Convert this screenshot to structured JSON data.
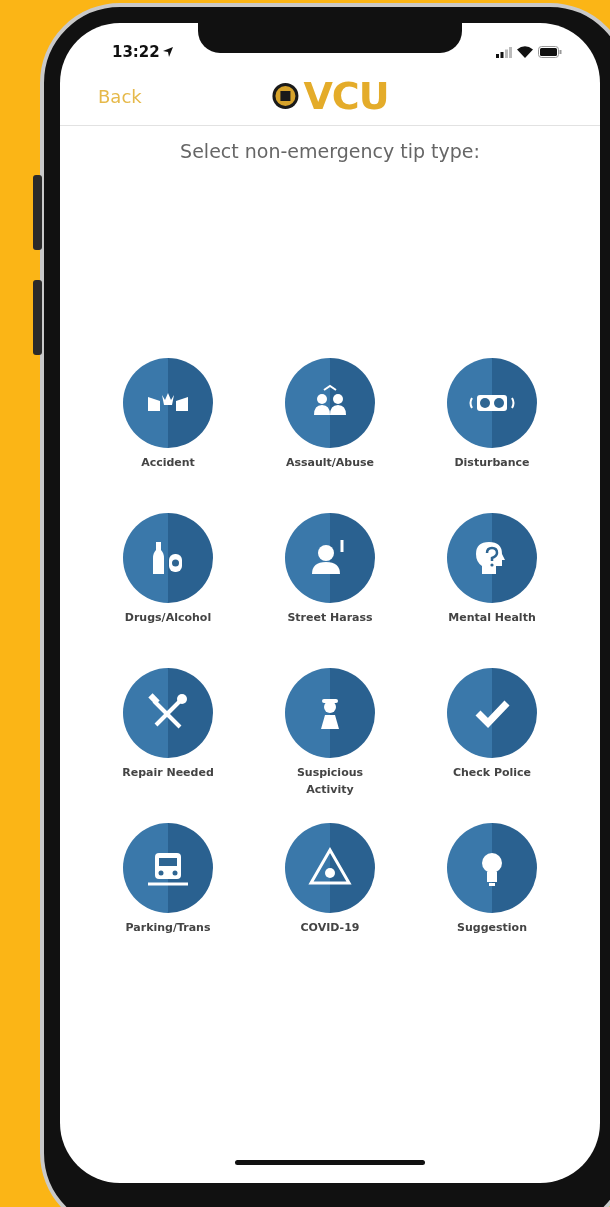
{
  "status_bar": {
    "time": "13:22"
  },
  "header": {
    "back": "Back",
    "logo_text": "VCU"
  },
  "title": "Select non-emergency tip type:",
  "tip_types": [
    {
      "label": "Accident"
    },
    {
      "label": "Assault/Abuse"
    },
    {
      "label": "Disturbance"
    },
    {
      "label": "Drugs/Alcohol"
    },
    {
      "label": "Street Harass"
    },
    {
      "label": "Mental Health"
    },
    {
      "label": "Repair Needed"
    },
    {
      "label": "Suspicious Activity"
    },
    {
      "label": "Check Police"
    },
    {
      "label": "Parking/Trans"
    },
    {
      "label": "COVID-19"
    },
    {
      "label": "Suggestion"
    }
  ]
}
